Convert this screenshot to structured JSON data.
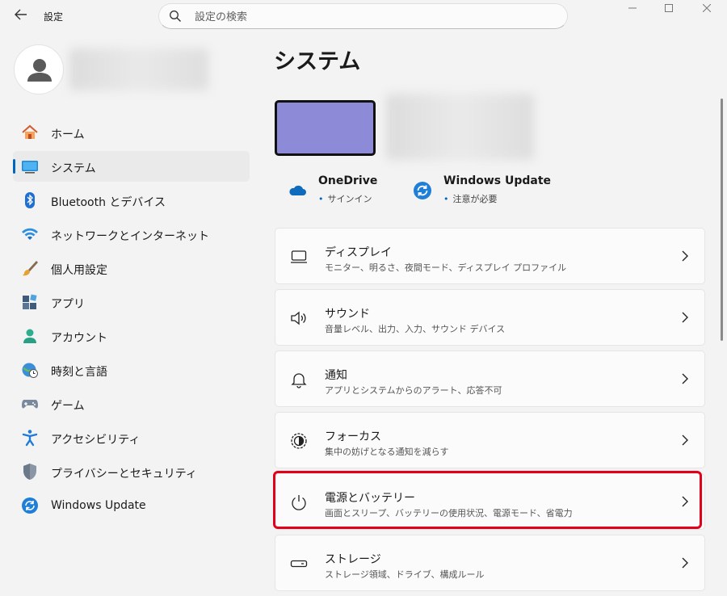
{
  "app": {
    "title": "設定"
  },
  "search": {
    "placeholder": "設定の検索"
  },
  "window_controls": {
    "minimize": "—",
    "maximize": "☐",
    "close": "✕"
  },
  "sidebar": {
    "items": [
      {
        "label": "ホーム",
        "icon": "home-icon"
      },
      {
        "label": "システム",
        "icon": "system-icon",
        "active": true
      },
      {
        "label": "Bluetooth とデバイス",
        "icon": "bluetooth-icon"
      },
      {
        "label": "ネットワークとインターネット",
        "icon": "wifi-icon"
      },
      {
        "label": "個人用設定",
        "icon": "brush-icon"
      },
      {
        "label": "アプリ",
        "icon": "apps-icon"
      },
      {
        "label": "アカウント",
        "icon": "account-icon"
      },
      {
        "label": "時刻と言語",
        "icon": "globe-clock-icon"
      },
      {
        "label": "ゲーム",
        "icon": "gamepad-icon"
      },
      {
        "label": "アクセシビリティ",
        "icon": "accessibility-icon"
      },
      {
        "label": "プライバシーとセキュリティ",
        "icon": "shield-icon"
      },
      {
        "label": "Windows Update",
        "icon": "update-icon"
      }
    ]
  },
  "main": {
    "title": "システム",
    "status": [
      {
        "name": "OneDrive",
        "sub": "サインイン",
        "icon": "cloud-icon"
      },
      {
        "name": "Windows Update",
        "sub": "注意が必要",
        "icon": "update-icon"
      }
    ],
    "cards": [
      {
        "title": "ディスプレイ",
        "desc": "モニター、明るさ、夜間モード、ディスプレイ プロファイル",
        "icon": "display-icon"
      },
      {
        "title": "サウンド",
        "desc": "音量レベル、出力、入力、サウンド デバイス",
        "icon": "speaker-icon"
      },
      {
        "title": "通知",
        "desc": "アプリとシステムからのアラート、応答不可",
        "icon": "bell-icon"
      },
      {
        "title": "フォーカス",
        "desc": "集中の妨げとなる通知を減らす",
        "icon": "focus-icon"
      },
      {
        "title": "電源とバッテリー",
        "desc": "画面とスリープ、バッテリーの使用状況、電源モード、省電力",
        "icon": "power-icon",
        "highlighted": true
      },
      {
        "title": "ストレージ",
        "desc": "ストレージ領域、ドライブ、構成ルール",
        "icon": "storage-icon"
      }
    ]
  },
  "colors": {
    "accent": "#0067c0",
    "highlight": "#e3001b",
    "device": "#8d8ad8"
  }
}
